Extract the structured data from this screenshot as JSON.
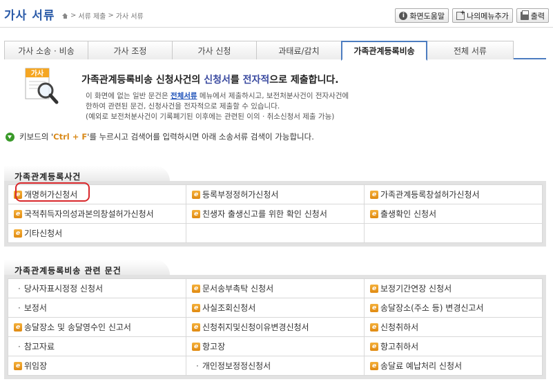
{
  "header": {
    "title": "가사 서류",
    "breadcrumb": [
      "서류 제출",
      "가사 서류"
    ],
    "separator": ">",
    "buttons": [
      {
        "label": "화면도움말",
        "icon": "info-icon"
      },
      {
        "label": "나의메뉴추가",
        "icon": "add-menu-icon"
      },
      {
        "label": "출력",
        "icon": "printer-icon"
      }
    ]
  },
  "tabs": [
    {
      "label": "가사 소송 · 비송",
      "active": false
    },
    {
      "label": "가사 조정",
      "active": false
    },
    {
      "label": "가사 신청",
      "active": false
    },
    {
      "label": "과태료/감치",
      "active": false
    },
    {
      "label": "가족관계등록비송",
      "active": true
    },
    {
      "label": "전체 서류",
      "active": false
    }
  ],
  "intro": {
    "icon_text": "가사",
    "title_parts": [
      "가족관계등록비송 신청사건의 ",
      "신청서",
      "를 ",
      "전자적",
      "으로 제출합니다."
    ],
    "desc_line1_pre": "이 화면에 없는 일반 문건은 ",
    "desc_link": "전체서류",
    "desc_line1_post": " 메뉴에서 제출하시고, 보전처분사건이 전자사건에",
    "desc_line2": "한하여 관련된 문건, 신청사건을 전자적으로 제출할 수 있습니다.",
    "desc_line3": "(예외로 보전처분사건이 기록폐기된 이후에는 관련된 이의 · 취소신청서 제출 가능)"
  },
  "tip": {
    "pre": "키보드의 '",
    "key": "Ctrl + F",
    "post": "'를 누르시고 검색어를 입력하시면 아래 소송서류 검색이 가능합니다."
  },
  "section1": {
    "title": "가족관계등록사건",
    "rows": [
      [
        {
          "t": "개명허가신청서",
          "ic": true
        },
        {
          "t": "등록부정정허가신청서",
          "ic": true
        },
        {
          "t": "가족관계등록창설허가신청서",
          "ic": true
        }
      ],
      [
        {
          "t": "국적취득자의성과본의창설허가신청서",
          "ic": true
        },
        {
          "t": "친생자 출생신고를 위한 확인 신청서",
          "ic": true
        },
        {
          "t": "출생확인 신청서",
          "ic": true
        }
      ],
      [
        {
          "t": "기타신청서",
          "ic": true
        },
        {
          "t": "",
          "ic": false
        },
        {
          "t": "",
          "ic": false
        }
      ]
    ]
  },
  "section2": {
    "title": "가족관계등록비송 관련 문건",
    "rows": [
      [
        {
          "t": "당사자표시정정 신청서",
          "ic": false
        },
        {
          "t": "문서송부촉탁 신청서",
          "ic": true
        },
        {
          "t": "보정기간연장 신청서",
          "ic": true
        }
      ],
      [
        {
          "t": "보정서",
          "ic": false
        },
        {
          "t": "사실조회신청서",
          "ic": true
        },
        {
          "t": "송달장소(주소 등) 변경신고서",
          "ic": true
        }
      ],
      [
        {
          "t": "송달장소 및 송달영수인 신고서",
          "ic": true
        },
        {
          "t": "신청취지및신청이유변경신청서",
          "ic": true
        },
        {
          "t": "신청취하서",
          "ic": true
        }
      ],
      [
        {
          "t": "참고자료",
          "ic": false
        },
        {
          "t": "항고장",
          "ic": true
        },
        {
          "t": "항고취하서",
          "ic": true
        }
      ],
      [
        {
          "t": "위임장",
          "ic": true
        },
        {
          "t": "개인정보정정신청서",
          "ic": false
        },
        {
          "t": "송달료 예납처리 신청서",
          "ic": true
        }
      ]
    ]
  },
  "colors": {
    "accent": "#4c7cc0",
    "title": "#2a5aa8",
    "doc_icon": "#e99a20",
    "highlight_ring": "#d8262a",
    "tip_icon": "#3a9a2a"
  }
}
